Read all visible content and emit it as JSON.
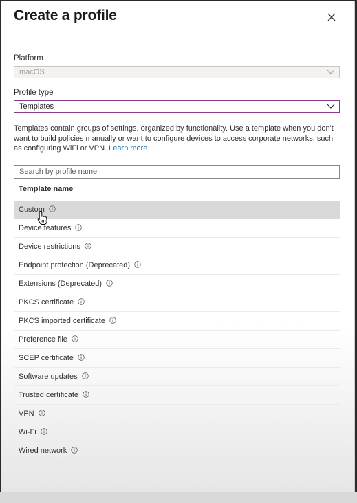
{
  "dialog": {
    "title": "Create a profile",
    "close_icon": "close-icon"
  },
  "platform": {
    "label": "Platform",
    "value": "macOS"
  },
  "profile_type": {
    "label": "Profile type",
    "value": "Templates"
  },
  "description": {
    "text": "Templates contain groups of settings, organized by functionality. Use a template when you don't want to build policies manually or want to configure devices to access corporate networks, such as configuring WiFi or VPN.",
    "link": "Learn more"
  },
  "search": {
    "placeholder": "Search by profile name"
  },
  "table": {
    "header": "Template name",
    "selected_index": 0,
    "rows": [
      {
        "name": "Custom"
      },
      {
        "name": "Device features"
      },
      {
        "name": "Device restrictions"
      },
      {
        "name": "Endpoint protection (Deprecated)"
      },
      {
        "name": "Extensions (Deprecated)"
      },
      {
        "name": "PKCS certificate"
      },
      {
        "name": "PKCS imported certificate"
      },
      {
        "name": "Preference file"
      },
      {
        "name": "SCEP certificate"
      },
      {
        "name": "Software updates"
      },
      {
        "name": "Trusted certificate"
      },
      {
        "name": "VPN"
      },
      {
        "name": "Wi-Fi"
      },
      {
        "name": "Wired network"
      }
    ]
  },
  "colors": {
    "accent_border": "#8a3a8f",
    "link": "#0f6cbd",
    "selected_row": "#d9d9d9"
  }
}
